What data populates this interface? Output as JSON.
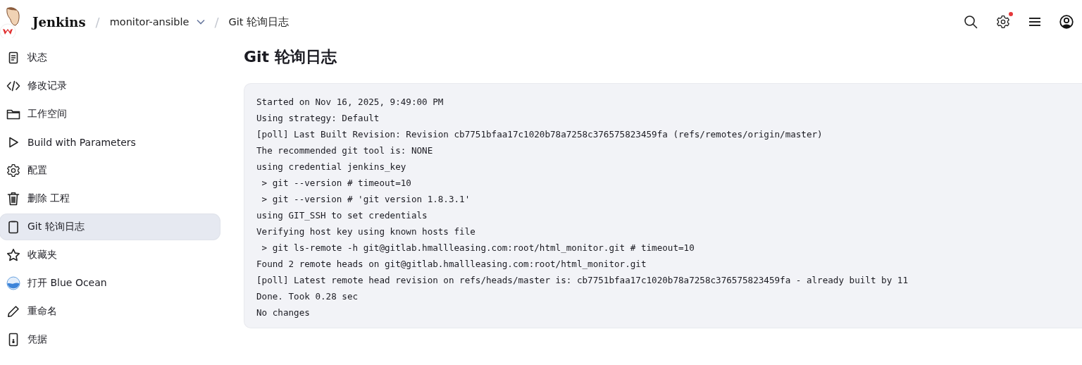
{
  "header": {
    "brand": "Jenkins",
    "breadcrumbs": [
      {
        "separator": "/",
        "label": "monitor-ansible",
        "dropdown": true
      },
      {
        "separator": "/",
        "label": "Git 轮询日志",
        "dropdown": false
      }
    ],
    "actions": [
      {
        "kind": "search",
        "badge": false
      },
      {
        "kind": "settings",
        "badge": true
      },
      {
        "kind": "menu",
        "badge": false
      },
      {
        "kind": "user",
        "badge": false
      }
    ]
  },
  "sidebar": {
    "items": [
      {
        "label": "状态",
        "kind": "document",
        "selected": false
      },
      {
        "label": "修改记录",
        "kind": "code",
        "selected": false
      },
      {
        "label": "工作空间",
        "kind": "folder",
        "selected": false
      },
      {
        "label": "Build with Parameters",
        "kind": "play",
        "selected": false
      },
      {
        "label": "配置",
        "kind": "gear",
        "selected": false
      },
      {
        "label": "删除 工程",
        "kind": "trash",
        "selected": false
      },
      {
        "label": "Git 轮询日志",
        "kind": "clipboard",
        "selected": true
      },
      {
        "label": "收藏夹",
        "kind": "star",
        "selected": false
      },
      {
        "label": "打开 Blue Ocean",
        "kind": "ocean",
        "selected": false
      },
      {
        "label": "重命名",
        "kind": "pencil",
        "selected": false
      },
      {
        "label": "凭据",
        "kind": "phone",
        "selected": false
      }
    ]
  },
  "main": {
    "title": "Git 轮询日志",
    "log": [
      "Started on Nov 16, 2025, 9:49:00 PM",
      "Using strategy: Default",
      "[poll] Last Built Revision: Revision cb7751bfaa17c1020b78a7258c376575823459fa (refs/remotes/origin/master)",
      "The recommended git tool is: NONE",
      "using credential jenkins_key",
      " > git --version # timeout=10",
      " > git --version # 'git version 1.8.3.1'",
      "using GIT_SSH to set credentials",
      "Verifying host key using known hosts file",
      " > git ls-remote -h git@gitlab.hmallleasing.com:root/html_monitor.git # timeout=10",
      "Found 2 remote heads on git@gitlab.hmallleasing.com:root/html_monitor.git",
      "[poll] Latest remote head revision on refs/heads/master is: cb7751bfaa17c1020b78a7258c376575823459fa - already built by 11",
      "Done. Took 0.28 sec",
      "No changes"
    ]
  }
}
